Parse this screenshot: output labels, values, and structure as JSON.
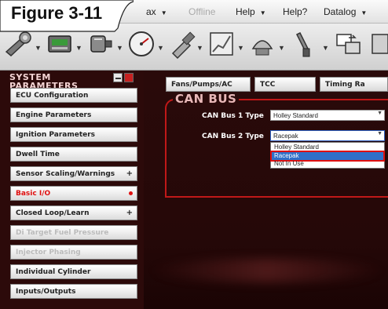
{
  "figure_label": "Figure 3-11",
  "menu": {
    "items": [
      {
        "label": "ax",
        "dim": false,
        "arrow": "▼"
      },
      {
        "label": "Offline",
        "dim": true,
        "arrow": ""
      },
      {
        "label": "Help",
        "dim": false,
        "arrow": "▼"
      },
      {
        "label": "Help?",
        "dim": false,
        "arrow": ""
      },
      {
        "label": "Datalog",
        "dim": false,
        "arrow": "▼"
      }
    ]
  },
  "toolbar": {
    "tools": [
      "wrench-icon",
      "ecu-icon",
      "sensor-icon",
      "gauge-icon",
      "injector-icon",
      "chart-icon",
      "data-icon",
      "probe-icon",
      "compare-icon"
    ]
  },
  "sidebar": {
    "title_line1": "SYSTEM",
    "title_line2": "PARAMETERS",
    "items": [
      {
        "label": "ECU Configuration",
        "state": "normal",
        "marker": ""
      },
      {
        "label": "Engine Parameters",
        "state": "normal",
        "marker": ""
      },
      {
        "label": "Ignition Parameters",
        "state": "normal",
        "marker": ""
      },
      {
        "label": "Dwell Time",
        "state": "normal",
        "marker": ""
      },
      {
        "label": "Sensor Scaling/Warnings",
        "state": "normal",
        "marker": "+"
      },
      {
        "label": "Basic I/O",
        "state": "active",
        "marker": "dot"
      },
      {
        "label": "Closed Loop/Learn",
        "state": "normal",
        "marker": "+"
      },
      {
        "label": "Di Target Fuel Pressure",
        "state": "disabled",
        "marker": ""
      },
      {
        "label": "Injector Phasing",
        "state": "disabled",
        "marker": ""
      },
      {
        "label": "Individual Cylinder",
        "state": "normal",
        "marker": ""
      },
      {
        "label": "Inputs/Outputs",
        "state": "normal",
        "marker": ""
      }
    ]
  },
  "tabs": [
    {
      "label": "Fans/Pumps/AC"
    },
    {
      "label": "TCC"
    },
    {
      "label": "Timing Ra"
    }
  ],
  "can_bus": {
    "title": "CAN BUS",
    "field1_label": "CAN Bus 1 Type",
    "field1_value": "Holley Standard",
    "field2_label": "CAN Bus 2 Type",
    "field2_value": "Racepak",
    "options": [
      "Holley Standard",
      "Racepak",
      "Not In Use"
    ],
    "selected_option": "Racepak"
  },
  "colors": {
    "accent_red": "#e01010",
    "panel_dark": "#2a0a0a",
    "selection_blue": "#2f6fc8"
  }
}
